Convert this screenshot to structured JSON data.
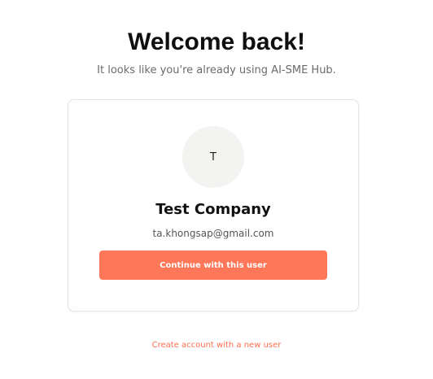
{
  "header": {
    "title": "Welcome back!",
    "subtitle": "It looks like you're already using AI-SME Hub."
  },
  "user_card": {
    "avatar_initial": "T",
    "company_name": "Test Company",
    "email": "ta.khongsap@gmail.com",
    "continue_label": "Continue with this user"
  },
  "footer": {
    "create_account_label": "Create account with a new user"
  },
  "colors": {
    "accent": "#ff7759",
    "link": "#ff6f4f",
    "avatar_bg": "#f3f3f1",
    "card_border": "#e4e4e4"
  }
}
